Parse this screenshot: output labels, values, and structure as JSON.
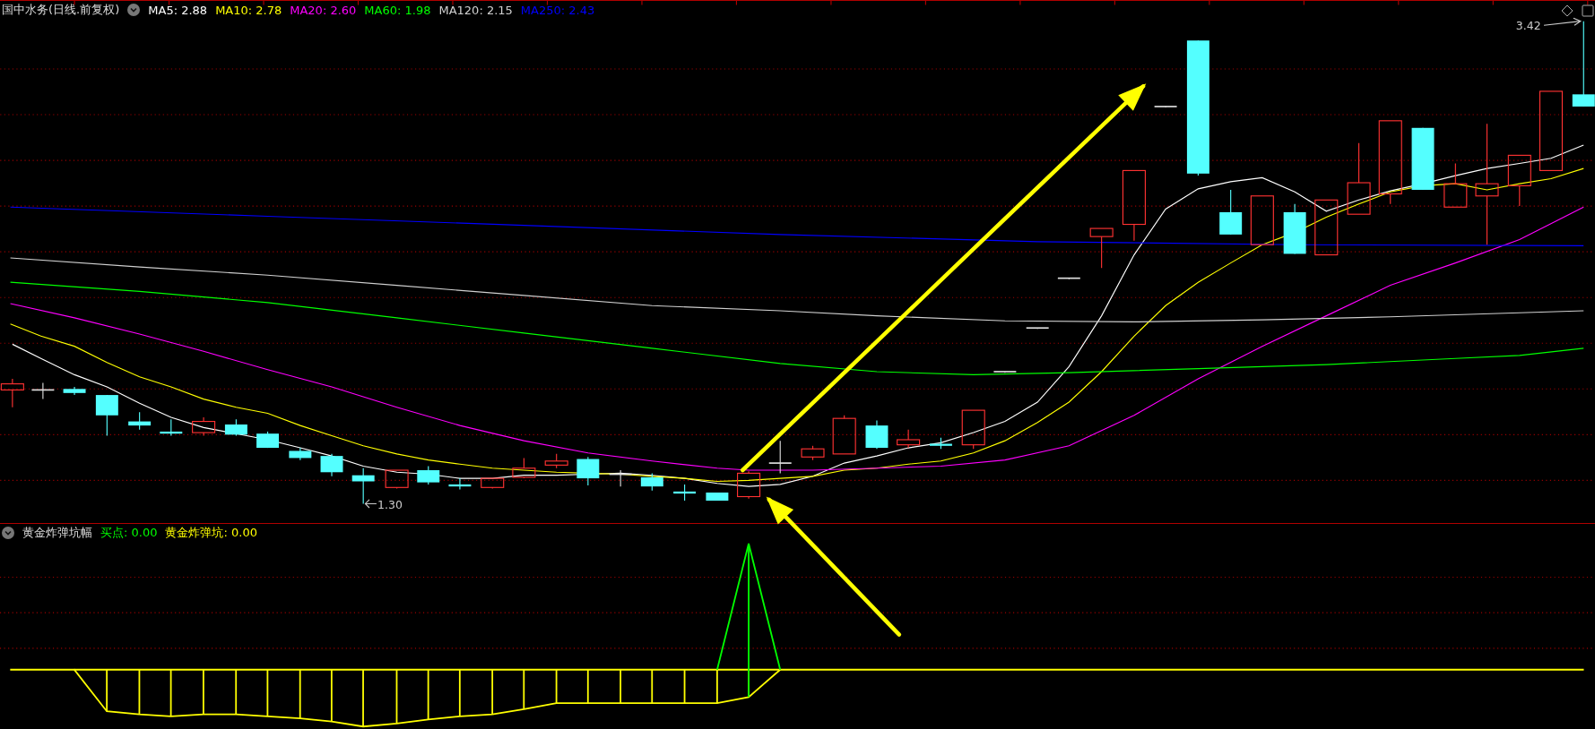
{
  "main_panel": {
    "title": "国中水务(日线.前复权)",
    "indicators": [
      {
        "label": "MA5: 2.88",
        "color": "#ffffff"
      },
      {
        "label": "MA10: 2.78",
        "color": "#ffff00"
      },
      {
        "label": "MA20: 2.60",
        "color": "#ff00ff"
      },
      {
        "label": "MA60: 1.98",
        "color": "#00ff00"
      },
      {
        "label": "MA120: 2.15",
        "color": "#d0d0d0"
      },
      {
        "label": "MA250: 2.43",
        "color": "#0000ff"
      }
    ],
    "high_label": "3.42",
    "low_label": "1.30"
  },
  "sub_panel": {
    "title": "黄金炸弹坑幅",
    "indicators": [
      {
        "label": "买点: 0.00",
        "color": "#00ff00"
      },
      {
        "label": "黄金炸弹坑: 0.00",
        "color": "#ffff00"
      }
    ]
  }
}
